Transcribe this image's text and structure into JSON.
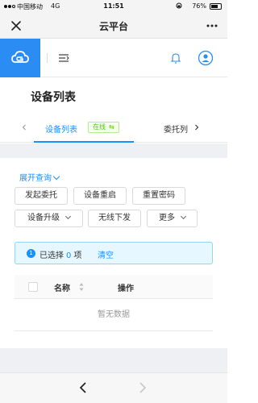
{
  "status_bar": {
    "carrier": "中国移动",
    "network": "4G",
    "time": "11:51",
    "battery_percent": "76%",
    "battery_level": 0.76
  },
  "nav_bar": {
    "title": "云平台"
  },
  "header": {
    "brand_color": "#2b8cf3"
  },
  "page": {
    "title": "设备列表"
  },
  "tabs": {
    "active": "设备列表",
    "badge": "在线",
    "next": "委托列"
  },
  "filters": {
    "expand_label": "展开查询",
    "buttons": {
      "initiate": "发起委托",
      "restart": "设备重启",
      "reset_password": "重置密码",
      "upgrade": "设备升级",
      "wireless": "无线下发",
      "more": "更多"
    }
  },
  "selection": {
    "icon": "1",
    "prefix": "已选择",
    "count": "0",
    "suffix": "项",
    "clear": "清空"
  },
  "table": {
    "columns": [
      "名称",
      "操作"
    ],
    "empty_text": "暂无数据"
  },
  "colors": {
    "accent": "#1890ff",
    "online": "#52c41a"
  }
}
